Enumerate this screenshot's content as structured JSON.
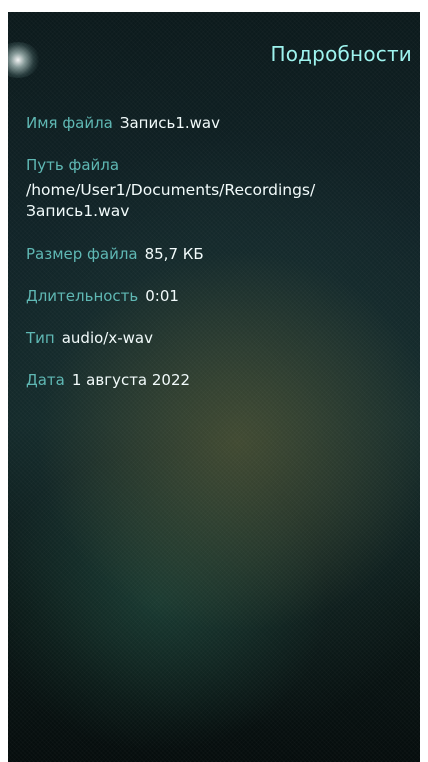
{
  "header": {
    "title": "Подробности"
  },
  "details": {
    "file_name": {
      "label": "Имя файла",
      "value": "Запись1.wav"
    },
    "file_path": {
      "label": "Путь файла",
      "value": "/home/User1/Documents/Recordings/Запись1.wav"
    },
    "file_size": {
      "label": "Размер файла",
      "value": "85,7 КБ"
    },
    "duration": {
      "label": "Длительность",
      "value": "0:01"
    },
    "type": {
      "label": "Тип",
      "value": "audio/x-wav"
    },
    "date": {
      "label": "Дата",
      "value": "1 августа 2022"
    }
  },
  "colors": {
    "title": "#9ef3ee",
    "label": "#5fb8b4",
    "value": "#f2fbfb",
    "background": "#112428"
  }
}
